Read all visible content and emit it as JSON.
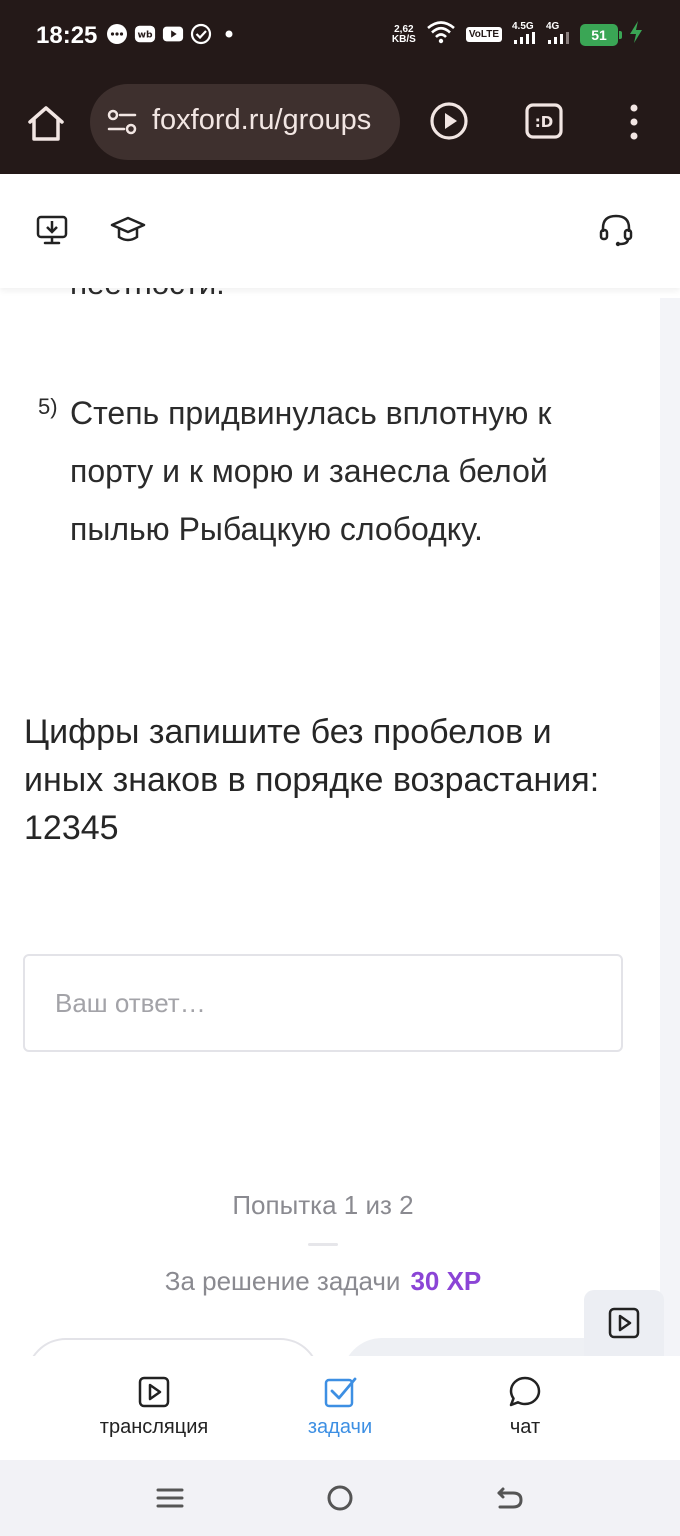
{
  "status_bar": {
    "time": "18:25",
    "speed_value": "2,62",
    "speed_unit": "KB/S",
    "volte": "VoLTE",
    "net_a": "4.5G",
    "net_b": "4G",
    "battery": "51"
  },
  "browser": {
    "url": "foxford.ru/groups",
    "tab_label": ":D"
  },
  "content": {
    "cut_text": "неетности.",
    "item_number": "5)",
    "item_text": "Степь придвинулась вплотную к порту и к морю и занесла белой пылью Рыбацкую слободку.",
    "instruction": "Цифры запишите без пробелов и иных знаков в порядке возрастания: 12345",
    "answer_placeholder": "Ваш ответ…",
    "attempt": "Попытка 1 из 2",
    "reward_label": "За решение задачи",
    "reward_xp": "30 XP"
  },
  "bottom_nav": {
    "items": [
      {
        "label": "трансляция",
        "icon": "play-square-icon"
      },
      {
        "label": "задачи",
        "icon": "checkbox-icon"
      },
      {
        "label": "чат",
        "icon": "chat-bubble-icon"
      }
    ],
    "active": 1
  },
  "colors": {
    "browser_bar": "#241918",
    "accent_blue": "#3d8fe3",
    "xp_purple": "#8b45d6"
  }
}
